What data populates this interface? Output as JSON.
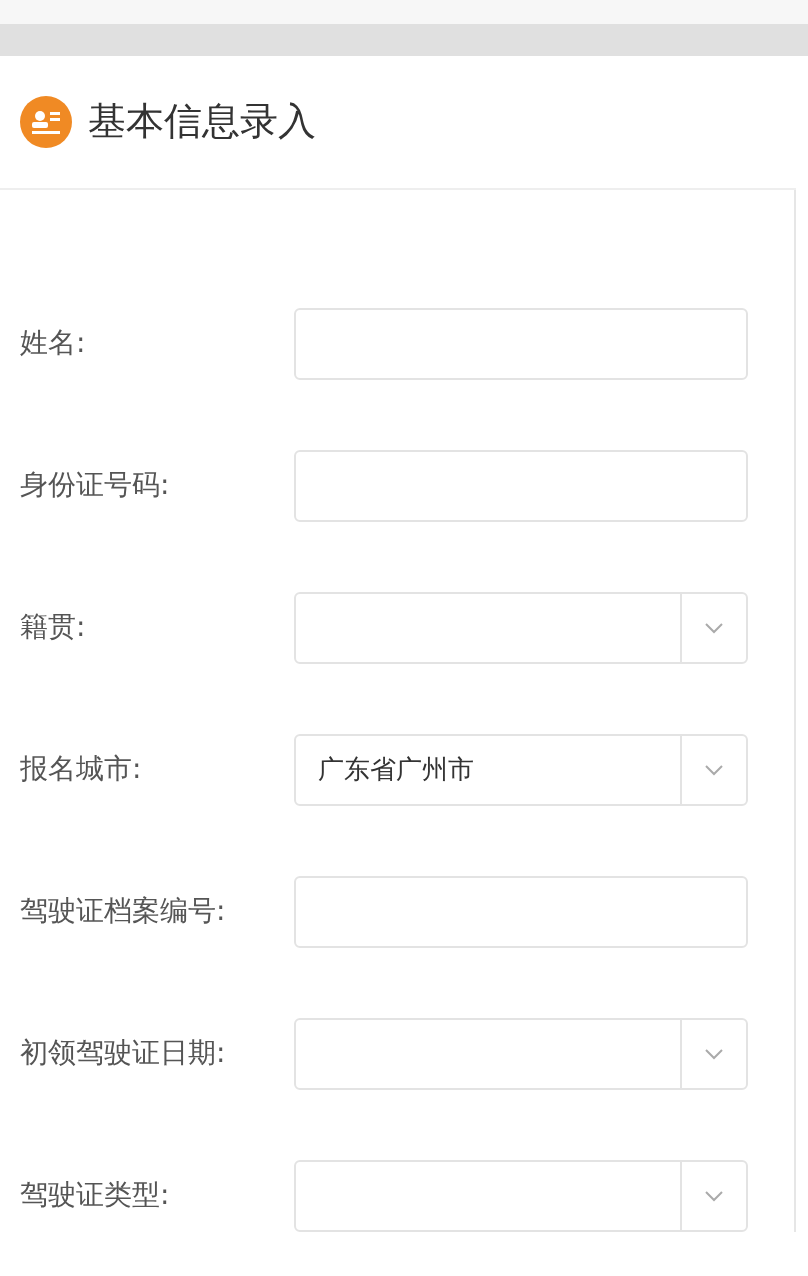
{
  "header": {
    "title": "基本信息录入"
  },
  "fields": [
    {
      "label": "姓名:",
      "kind": "text"
    },
    {
      "label": "身份证号码:",
      "kind": "text"
    },
    {
      "label": "籍贯:",
      "kind": "select"
    },
    {
      "label": "报名城市:",
      "kind": "select",
      "value": "广东省广州市"
    },
    {
      "label": "驾驶证档案编号:",
      "kind": "text"
    },
    {
      "label": "初领驾驶证日期:",
      "kind": "select"
    },
    {
      "label": "驾驶证类型:",
      "kind": "select"
    }
  ]
}
